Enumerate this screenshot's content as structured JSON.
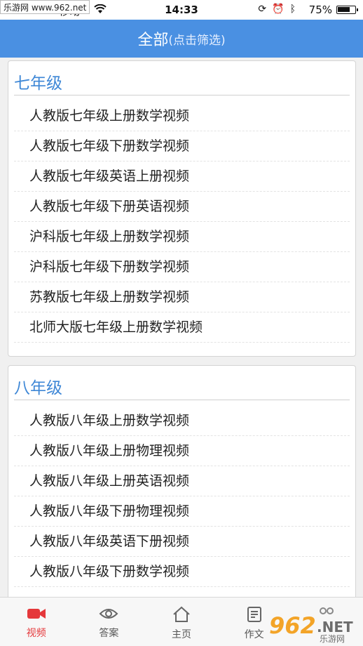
{
  "status_bar": {
    "watermark": "乐游网 www.962.net",
    "carrier": "移动",
    "time": "14:33",
    "battery": "75%",
    "battery_level": 0.75
  },
  "header": {
    "title": "全部",
    "subtitle": "(点击筛选)"
  },
  "sections": [
    {
      "title": "七年级",
      "items": [
        "人教版七年级上册数学视频",
        "人教版七年级下册数学视频",
        "人教版七年级英语上册视频",
        "人教版七年级下册英语视频",
        "沪科版七年级上册数学视频",
        "沪科版七年级下册数学视频",
        "苏教版七年级上册数学视频",
        "北师大版七年级上册数学视频"
      ]
    },
    {
      "title": "八年级",
      "items": [
        "人教版八年级上册数学视频",
        "人教版八年级上册物理视频",
        "人教版八年级上册英语视频",
        "人教版八年级下册物理视频",
        "人教版八年级英语下册视频",
        "人教版八年级下册数学视频"
      ]
    }
  ],
  "tabbar": {
    "tabs": [
      {
        "label": "视频",
        "icon": "video-camera-icon",
        "active": true
      },
      {
        "label": "答案",
        "icon": "eye-icon",
        "active": false
      },
      {
        "label": "主页",
        "icon": "home-icon",
        "active": false
      },
      {
        "label": "作文",
        "icon": "document-icon",
        "active": false
      },
      {
        "label": "",
        "icon": "more-icon",
        "active": false
      }
    ]
  },
  "overlay_logo": {
    "text": "962",
    "suffix": ".NET",
    "tagline": "乐游网"
  },
  "colors": {
    "accent": "#4a90e2",
    "section_title": "#3e87d6",
    "active_tab": "#e5383b"
  }
}
